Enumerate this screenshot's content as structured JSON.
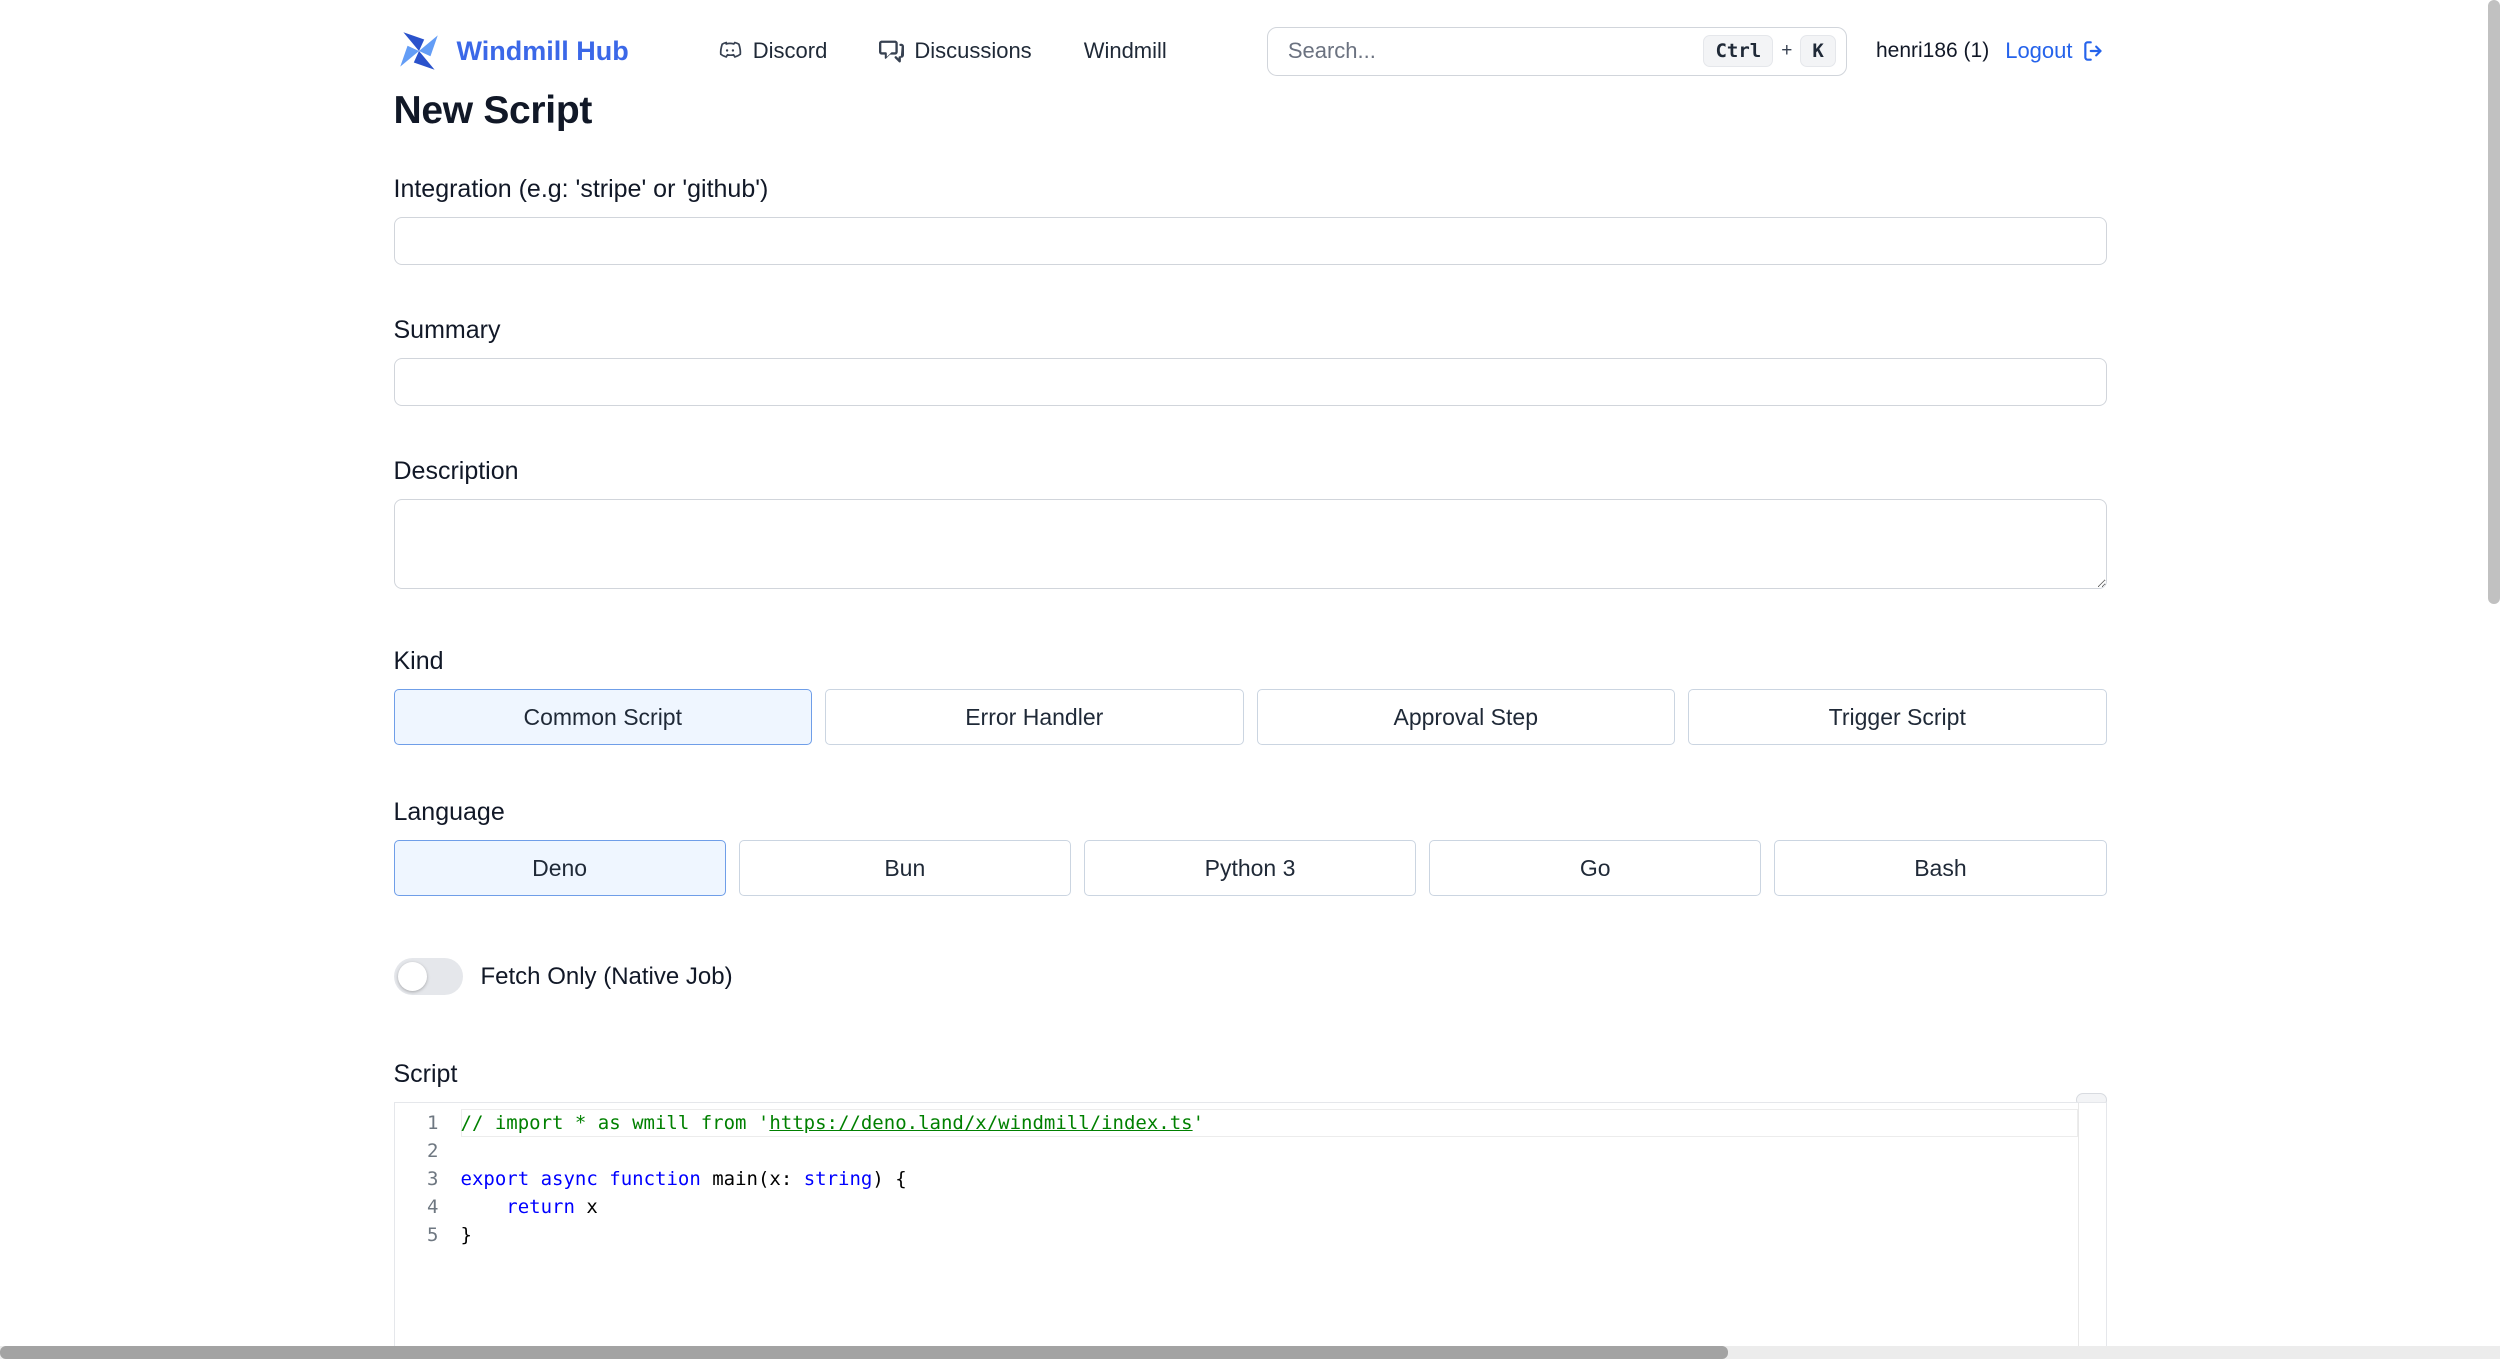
{
  "colors": {
    "brand_blue": "#3b68e8",
    "link_blue": "#2563eb",
    "selected_option_bg": "#eff6ff",
    "selected_option_border": "#6f9ee8",
    "input_border": "#d1d5db",
    "code_comment": "#008000",
    "code_keyword": "#0000ff"
  },
  "header": {
    "brand": "Windmill Hub",
    "nav": [
      {
        "label": "Discord"
      },
      {
        "label": "Discussions"
      },
      {
        "label": "Windmill"
      }
    ],
    "search": {
      "placeholder": "Search...",
      "keys": [
        "Ctrl",
        "K"
      ],
      "plus": "+"
    },
    "user": "henri186 (1)",
    "logout_label": "Logout"
  },
  "page": {
    "title": "New Script"
  },
  "form": {
    "integration": {
      "label": "Integration (e.g: 'stripe' or 'github')",
      "value": ""
    },
    "summary": {
      "label": "Summary",
      "value": ""
    },
    "description": {
      "label": "Description",
      "value": ""
    },
    "kind": {
      "label": "Kind",
      "options": [
        "Common Script",
        "Error Handler",
        "Approval Step",
        "Trigger Script"
      ],
      "selected": "Common Script"
    },
    "language": {
      "label": "Language",
      "options": [
        "Deno",
        "Bun",
        "Python 3",
        "Go",
        "Bash"
      ],
      "selected": "Deno"
    },
    "fetch_only": {
      "label": "Fetch Only (Native Job)",
      "enabled": false
    },
    "script_label": "Script"
  },
  "code": {
    "lines": [
      {
        "num": "1",
        "tokens": [
          {
            "t": "// import * as wmill from '",
            "c": "comment"
          },
          {
            "t": "https://deno.land/x/windmill/index.ts",
            "c": "comment-link"
          },
          {
            "t": "'",
            "c": "comment"
          }
        ]
      },
      {
        "num": "2",
        "tokens": []
      },
      {
        "num": "3",
        "tokens": [
          {
            "t": "export",
            "c": "keyword"
          },
          {
            "t": " ",
            "c": "plain"
          },
          {
            "t": "async",
            "c": "keyword"
          },
          {
            "t": " ",
            "c": "plain"
          },
          {
            "t": "function",
            "c": "keyword"
          },
          {
            "t": " main(x: ",
            "c": "plain"
          },
          {
            "t": "string",
            "c": "keyword"
          },
          {
            "t": ") {",
            "c": "plain"
          }
        ]
      },
      {
        "num": "4",
        "tokens": [
          {
            "t": "    ",
            "c": "plain"
          },
          {
            "t": "return",
            "c": "keyword"
          },
          {
            "t": " x",
            "c": "plain"
          }
        ]
      },
      {
        "num": "5",
        "tokens": [
          {
            "t": "}",
            "c": "plain"
          }
        ]
      }
    ]
  }
}
